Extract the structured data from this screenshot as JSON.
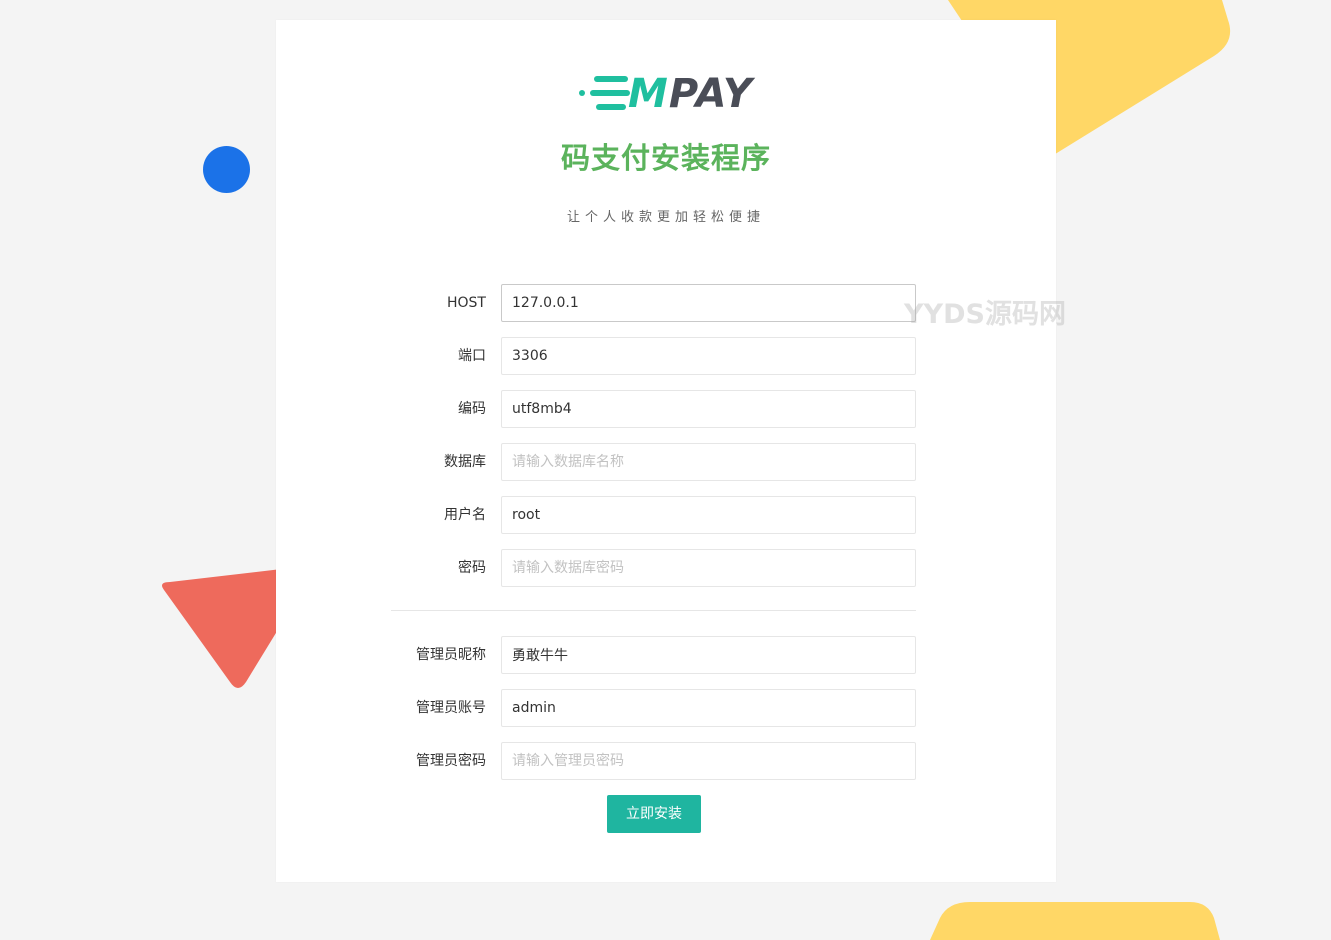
{
  "logo": {
    "text_first": "M",
    "text_rest": "PAY",
    "colors": {
      "accent": "#1fbf9f",
      "text": "#4a4d57"
    }
  },
  "header": {
    "title": "码支付安装程序",
    "subtitle": "让个人收款更加轻松便捷"
  },
  "form": {
    "db_fields": [
      {
        "label": "HOST",
        "value": "127.0.0.1",
        "placeholder": ""
      },
      {
        "label": "端口",
        "value": "3306",
        "placeholder": ""
      },
      {
        "label": "编码",
        "value": "utf8mb4",
        "placeholder": ""
      },
      {
        "label": "数据库",
        "value": "",
        "placeholder": "请输入数据库名称"
      },
      {
        "label": "用户名",
        "value": "root",
        "placeholder": ""
      },
      {
        "label": "密码",
        "value": "",
        "placeholder": "请输入数据库密码"
      }
    ],
    "admin_fields": [
      {
        "label": "管理员昵称",
        "value": "勇敢牛牛",
        "placeholder": ""
      },
      {
        "label": "管理员账号",
        "value": "admin",
        "placeholder": ""
      },
      {
        "label": "管理员密码",
        "value": "",
        "placeholder": "请输入管理员密码"
      }
    ],
    "submit_label": "立即安装"
  },
  "watermark": {
    "text": "YYDS源码网"
  },
  "colors": {
    "background": "#f4f4f4",
    "title": "#5bb35c",
    "button": "#1fb5a0",
    "deco_yellow": "#ffd766",
    "deco_blue": "#1b72e8",
    "deco_red": "#ee6a5c"
  }
}
